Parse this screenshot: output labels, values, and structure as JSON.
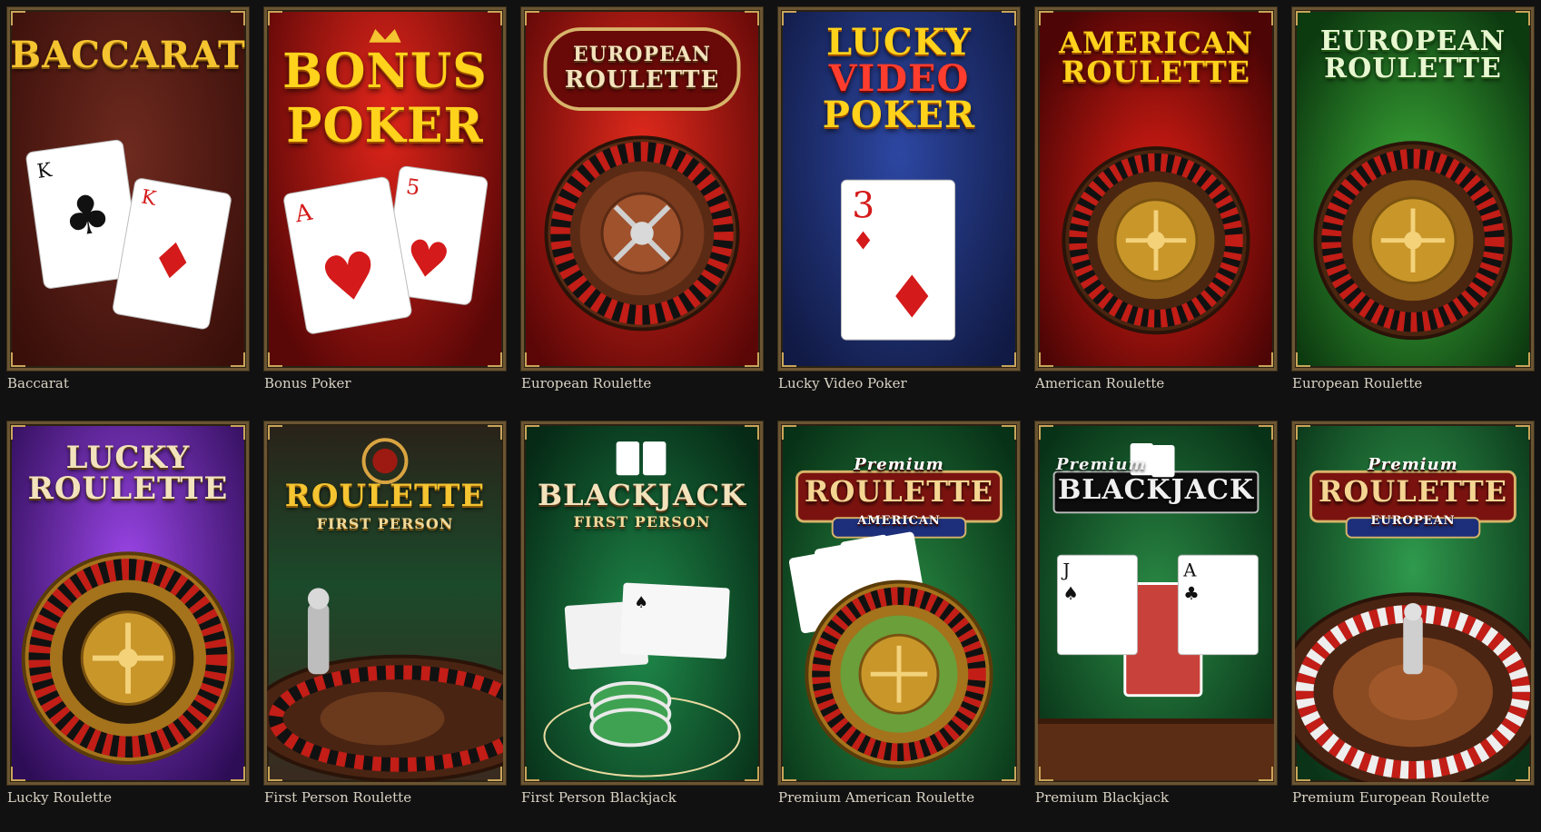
{
  "games": [
    {
      "caption": "Baccarat",
      "art": [
        "BACCARAT"
      ],
      "colors": {
        "bg": "#5a1d16",
        "bg2": "#3a0f0a"
      }
    },
    {
      "caption": "Bonus Poker",
      "art": [
        "BONUS",
        "POKER"
      ],
      "colors": {
        "bg": "#c81a0f",
        "bg2": "#4a0606"
      }
    },
    {
      "caption": "European Roulette",
      "art": [
        "EUROPEAN",
        "ROULETTE"
      ],
      "colors": {
        "bg": "#d31d14",
        "bg2": "#5c0707"
      }
    },
    {
      "caption": "Lucky Video Poker",
      "art": [
        "LUCKY",
        "VIDEO",
        "POKER"
      ],
      "colors": {
        "bg": "#243a8a",
        "bg2": "#111a44"
      }
    },
    {
      "caption": "American Roulette",
      "art": [
        "AMERICAN",
        "ROULETTE"
      ],
      "colors": {
        "bg": "#c51a10",
        "bg2": "#4d0505"
      }
    },
    {
      "caption": "European Roulette",
      "art": [
        "EUROPEAN",
        "ROULETTE"
      ],
      "colors": {
        "bg": "#2d8a2b",
        "bg2": "#0d3b10"
      }
    },
    {
      "caption": "Lucky Roulette",
      "art": [
        "LUCKY",
        "ROULETTE"
      ],
      "colors": {
        "bg": "#7c2ec7",
        "bg2": "#2e0d57"
      }
    },
    {
      "caption": "First Person Roulette",
      "art": [
        "ROULETTE",
        "FIRST PERSON"
      ],
      "colors": {
        "bg": "#3a2a1f",
        "bg2": "#0f0c0a"
      }
    },
    {
      "caption": "First Person Blackjack",
      "art": [
        "BLACKJACK",
        "FIRST PERSON"
      ],
      "colors": {
        "bg": "#176b39",
        "bg2": "#062a16"
      }
    },
    {
      "caption": "Premium American Roulette",
      "art": [
        "Premium",
        "ROULETTE",
        "AMERICAN"
      ],
      "colors": {
        "bg": "#1f6e34",
        "bg2": "#083217"
      }
    },
    {
      "caption": "Premium Blackjack",
      "art": [
        "Premium",
        "BLACKJACK"
      ],
      "colors": {
        "bg": "#1e6a34",
        "bg2": "#083217"
      }
    },
    {
      "caption": "Premium European Roulette",
      "art": [
        "Premium",
        "ROULETTE",
        "EUROPEAN"
      ],
      "colors": {
        "bg": "#24713a",
        "bg2": "#0a3318"
      }
    }
  ]
}
